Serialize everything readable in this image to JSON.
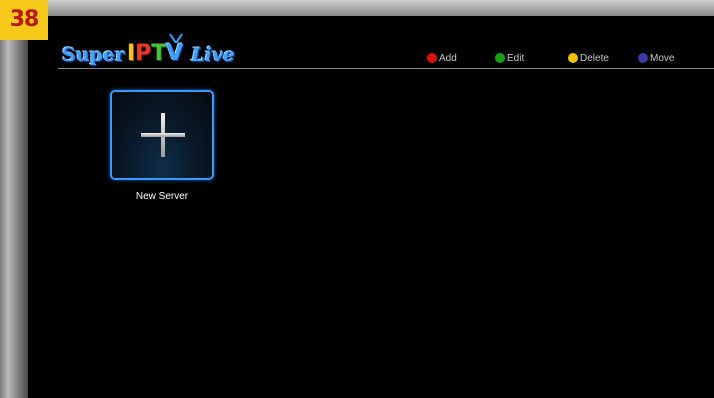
{
  "badge": {
    "text": "38"
  },
  "logo": {
    "super": "Super",
    "iptv": {
      "i": "I",
      "p": "P",
      "t": "T",
      "v": "V"
    },
    "live": "Live"
  },
  "legend": {
    "add": {
      "label": "Add",
      "color": "#e01010"
    },
    "edit": {
      "label": "Edit",
      "color": "#1aa01a"
    },
    "delete": {
      "label": "Delete",
      "color": "#f0c000"
    },
    "move": {
      "label": "Move",
      "color": "#3a3aa8"
    }
  },
  "servers": [
    {
      "label": "New Server",
      "icon": "plus-icon"
    }
  ]
}
